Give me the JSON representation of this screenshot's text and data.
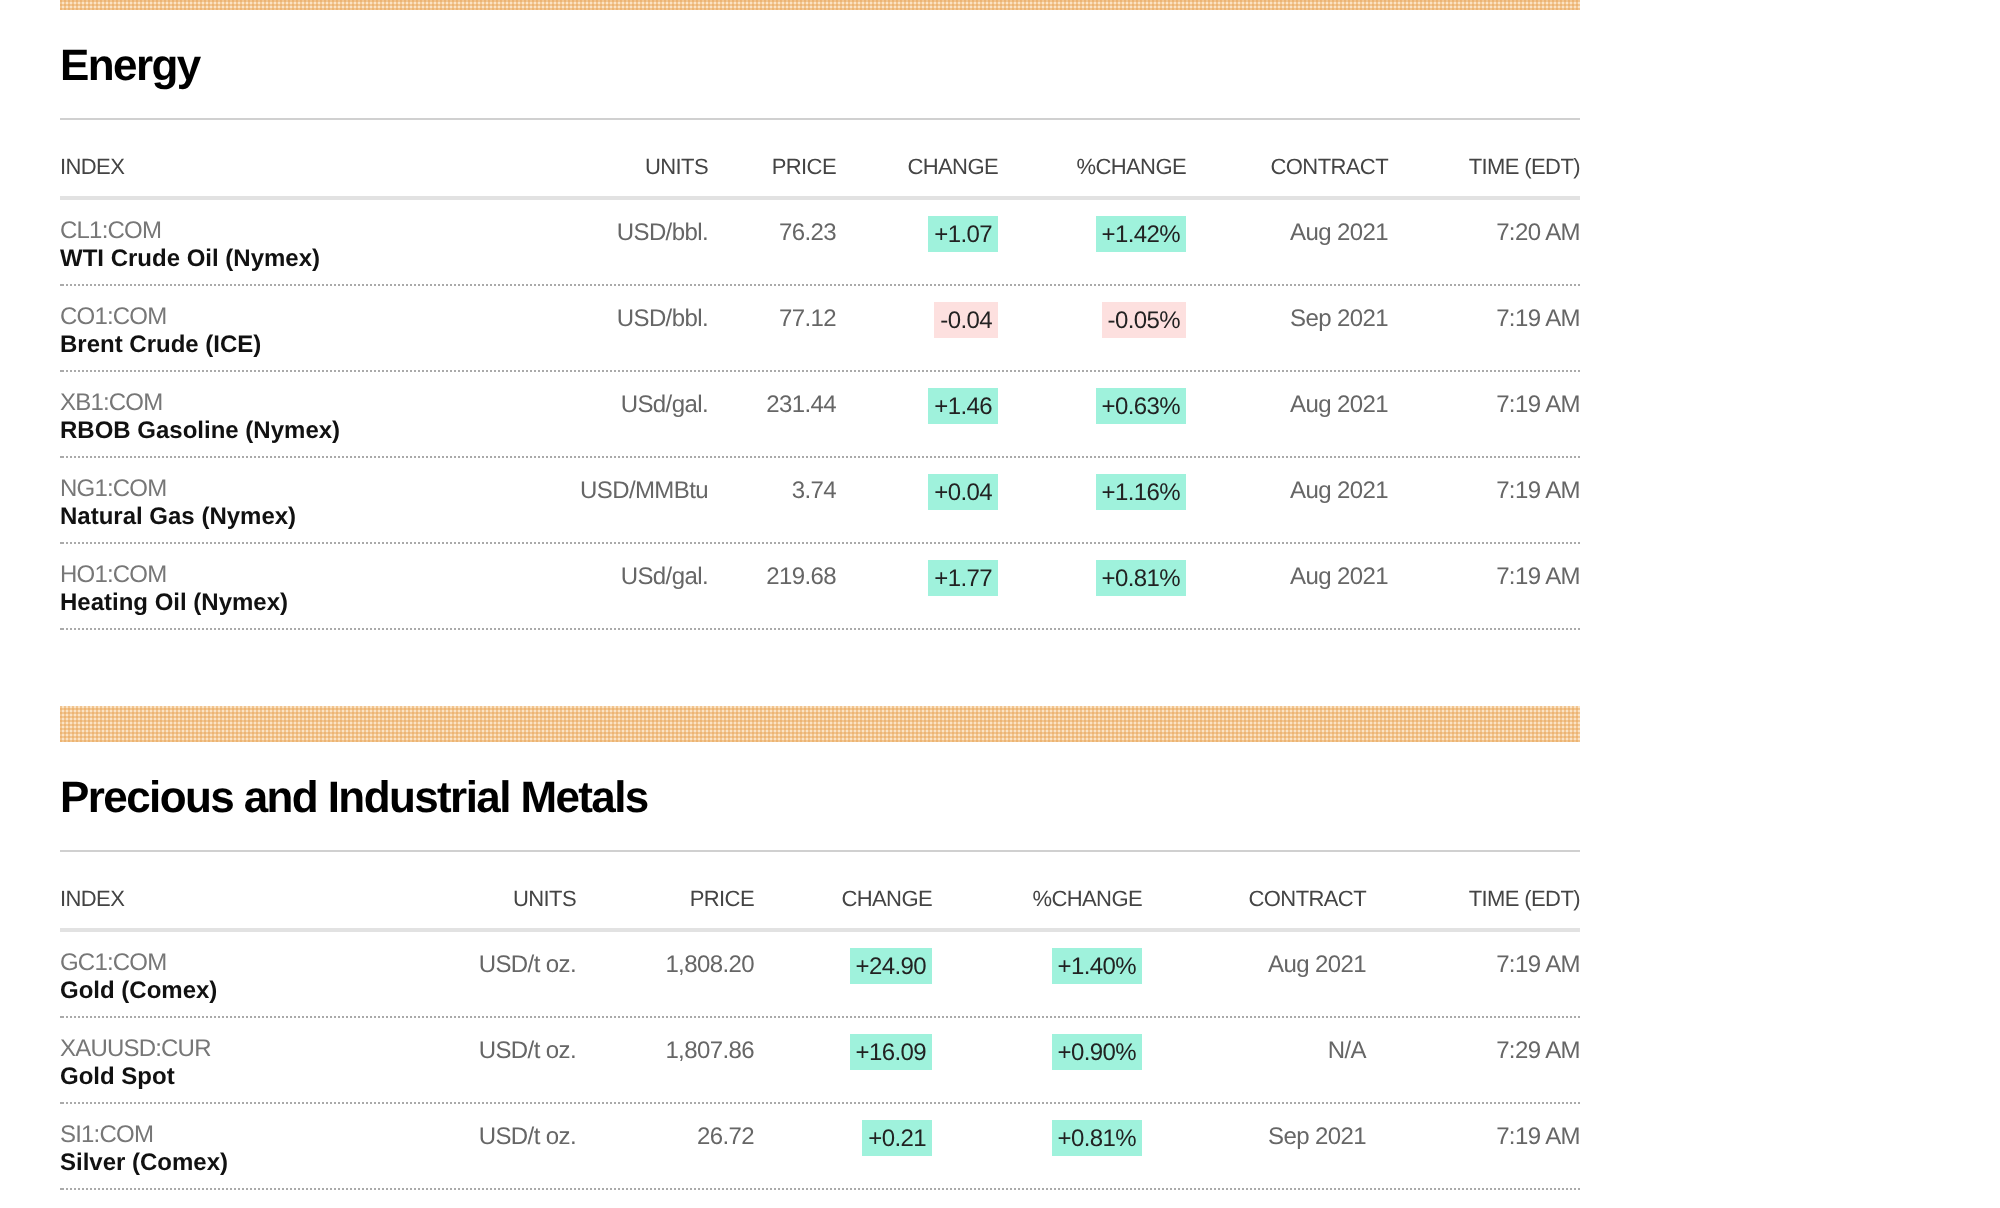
{
  "sections": [
    {
      "title": "Energy",
      "columns": [
        "INDEX",
        "UNITS",
        "PRICE",
        "CHANGE",
        "%CHANGE",
        "CONTRACT",
        "TIME (EDT)"
      ],
      "rows": [
        {
          "ticker": "CL1:COM",
          "name": "WTI Crude Oil (Nymex)",
          "units": "USD/bbl.",
          "price": "76.23",
          "change": "+1.07",
          "pct_change": "+1.42%",
          "kind": "up",
          "contract": "Aug 2021",
          "time": "7:20 AM"
        },
        {
          "ticker": "CO1:COM",
          "name": "Brent Crude (ICE)",
          "units": "USD/bbl.",
          "price": "77.12",
          "change": "-0.04",
          "pct_change": "-0.05%",
          "kind": "down",
          "contract": "Sep 2021",
          "time": "7:19 AM"
        },
        {
          "ticker": "XB1:COM",
          "name": "RBOB Gasoline (Nymex)",
          "units": "USd/gal.",
          "price": "231.44",
          "change": "+1.46",
          "pct_change": "+0.63%",
          "kind": "up",
          "contract": "Aug 2021",
          "time": "7:19 AM"
        },
        {
          "ticker": "NG1:COM",
          "name": "Natural Gas (Nymex)",
          "units": "USD/MMBtu",
          "price": "3.74",
          "change": "+0.04",
          "pct_change": "+1.16%",
          "kind": "up",
          "contract": "Aug 2021",
          "time": "7:19 AM"
        },
        {
          "ticker": "HO1:COM",
          "name": "Heating Oil (Nymex)",
          "units": "USd/gal.",
          "price": "219.68",
          "change": "+1.77",
          "pct_change": "+0.81%",
          "kind": "up",
          "contract": "Aug 2021",
          "time": "7:19 AM"
        }
      ]
    },
    {
      "title": "Precious and Industrial Metals",
      "columns": [
        "INDEX",
        "UNITS",
        "PRICE",
        "CHANGE",
        "%CHANGE",
        "CONTRACT",
        "TIME (EDT)"
      ],
      "rows": [
        {
          "ticker": "GC1:COM",
          "name": "Gold (Comex)",
          "units": "USD/t oz.",
          "price": "1,808.20",
          "change": "+24.90",
          "pct_change": "+1.40%",
          "kind": "up",
          "contract": "Aug 2021",
          "time": "7:19 AM"
        },
        {
          "ticker": "XAUUSD:CUR",
          "name": "Gold Spot",
          "units": "USD/t oz.",
          "price": "1,807.86",
          "change": "+16.09",
          "pct_change": "+0.90%",
          "kind": "up",
          "contract": "N/A",
          "time": "7:29 AM"
        },
        {
          "ticker": "SI1:COM",
          "name": "Silver (Comex)",
          "units": "USD/t oz.",
          "price": "26.72",
          "change": "+0.21",
          "pct_change": "+0.81%",
          "kind": "up",
          "contract": "Sep 2021",
          "time": "7:19 AM"
        }
      ]
    }
  ]
}
